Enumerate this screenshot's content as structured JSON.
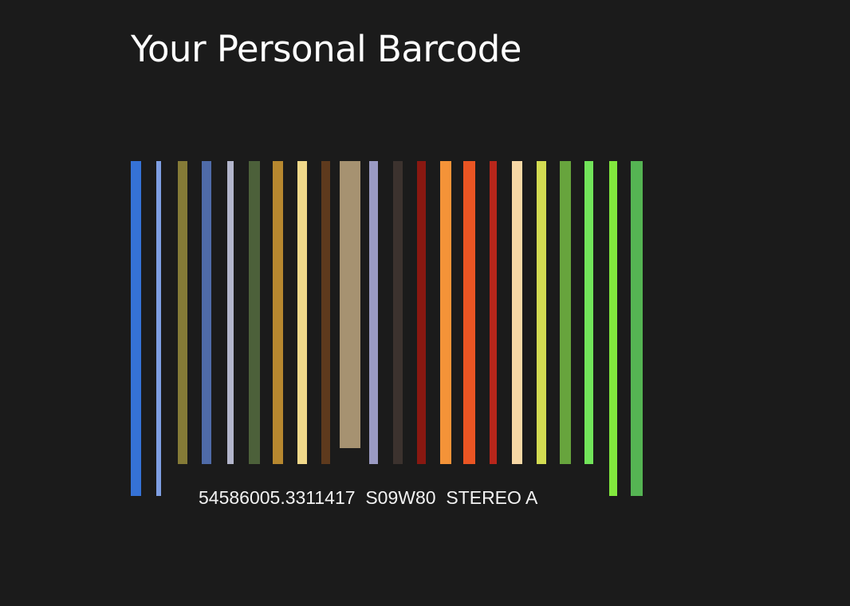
{
  "header": {
    "title": "Your Personal Barcode"
  },
  "barcode": {
    "caption_parts": [
      "54586005.3311417",
      "S09W80",
      "STEREO A"
    ],
    "bars": [
      {
        "color": "#3572d6",
        "height": "tall"
      },
      {
        "color": "#7f9fe3",
        "height": "tall"
      },
      {
        "color": "#857b37",
        "height": "normal"
      },
      {
        "color": "#4f6ba8",
        "height": "normal"
      },
      {
        "color": "#b3b6cc",
        "height": "normal"
      },
      {
        "color": "#4c603a",
        "height": "normal"
      },
      {
        "color": "#b7882f",
        "height": "normal"
      },
      {
        "color": "#f1d98a",
        "height": "normal"
      },
      {
        "color": "#5e3a1d",
        "height": "normal"
      },
      {
        "color": "#a69271",
        "height": "short"
      },
      {
        "color": "#9a9ac3",
        "height": "normal"
      },
      {
        "color": "#3c322e",
        "height": "normal"
      },
      {
        "color": "#891811",
        "height": "normal"
      },
      {
        "color": "#f49338",
        "height": "normal"
      },
      {
        "color": "#ea5523",
        "height": "normal"
      },
      {
        "color": "#b8261b",
        "height": "normal"
      },
      {
        "color": "#f7d8a5",
        "height": "normal"
      },
      {
        "color": "#d3dc52",
        "height": "normal"
      },
      {
        "color": "#67a43d",
        "height": "normal"
      },
      {
        "color": "#72e45a",
        "height": "normal"
      },
      {
        "color": "#82e83d",
        "height": "tall"
      },
      {
        "color": "#55b453",
        "height": "tall"
      }
    ]
  }
}
